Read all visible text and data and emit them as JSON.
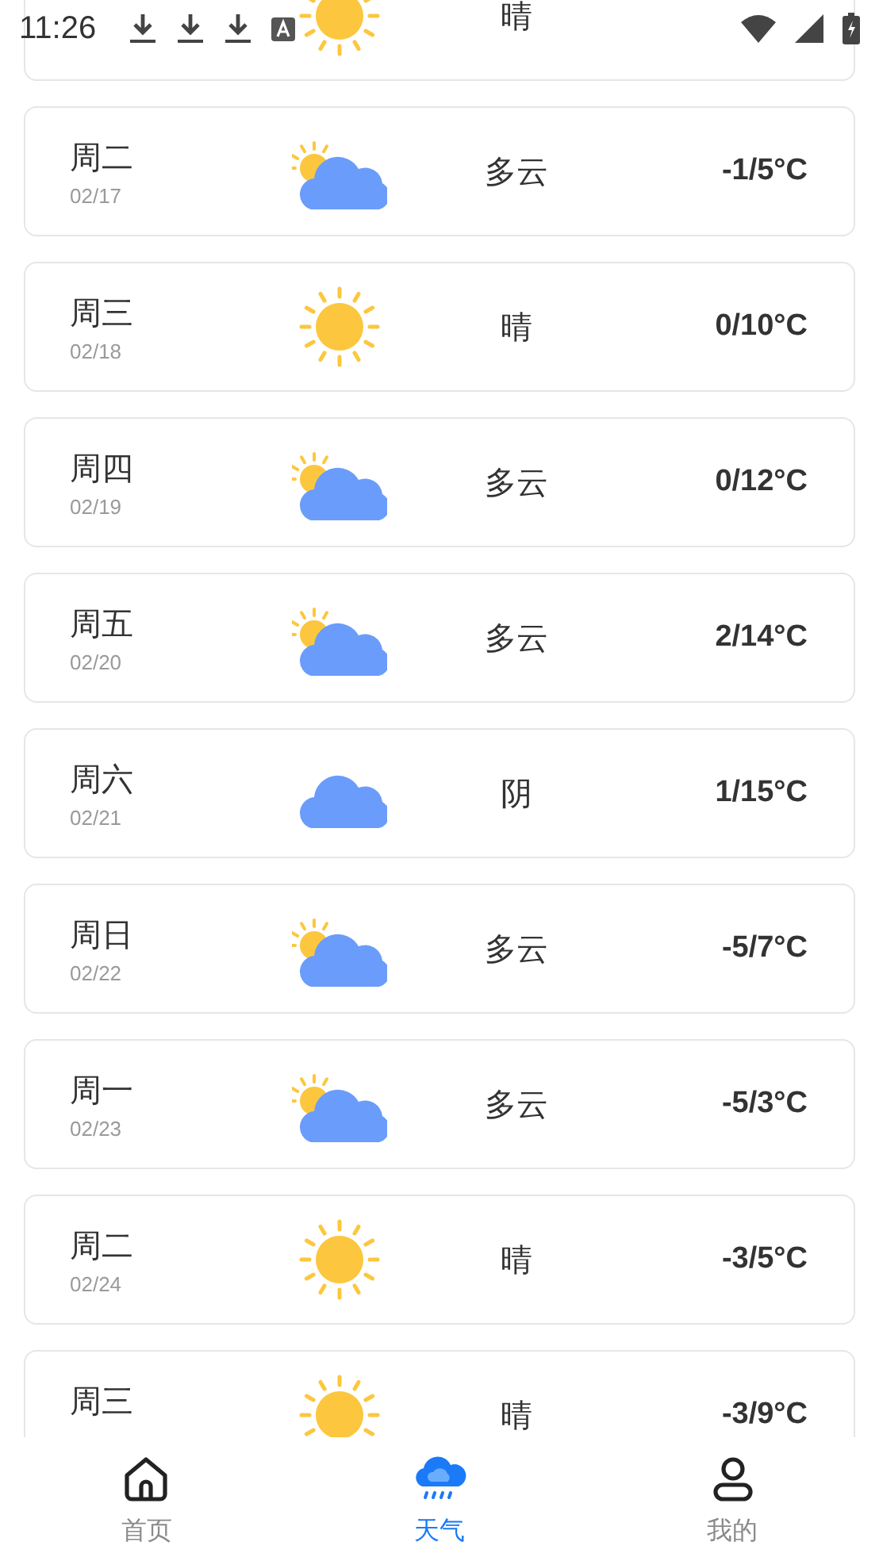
{
  "status_bar": {
    "time": "11:26"
  },
  "days": [
    {
      "kind": "sunny",
      "condition": "晴"
    },
    {
      "day": "周二",
      "date": "02/17",
      "kind": "partly",
      "condition": "多云",
      "temp": "-1/5°C"
    },
    {
      "day": "周三",
      "date": "02/18",
      "kind": "sunny",
      "condition": "晴",
      "temp": "0/10°C"
    },
    {
      "day": "周四",
      "date": "02/19",
      "kind": "partly",
      "condition": "多云",
      "temp": "0/12°C"
    },
    {
      "day": "周五",
      "date": "02/20",
      "kind": "partly",
      "condition": "多云",
      "temp": "2/14°C"
    },
    {
      "day": "周六",
      "date": "02/21",
      "kind": "cloudy",
      "condition": "阴",
      "temp": "1/15°C"
    },
    {
      "day": "周日",
      "date": "02/22",
      "kind": "partly",
      "condition": "多云",
      "temp": "-5/7°C"
    },
    {
      "day": "周一",
      "date": "02/23",
      "kind": "partly",
      "condition": "多云",
      "temp": "-5/3°C"
    },
    {
      "day": "周二",
      "date": "02/24",
      "kind": "sunny",
      "condition": "晴",
      "temp": "-3/5°C"
    },
    {
      "day": "周三",
      "kind": "sunny",
      "condition": "晴",
      "temp": "-3/9°C"
    }
  ],
  "nav": [
    {
      "kind": "home",
      "label": "首页",
      "selected": false
    },
    {
      "kind": "weather",
      "label": "天气",
      "selected": true
    },
    {
      "kind": "profile",
      "label": "我的",
      "selected": false
    }
  ]
}
